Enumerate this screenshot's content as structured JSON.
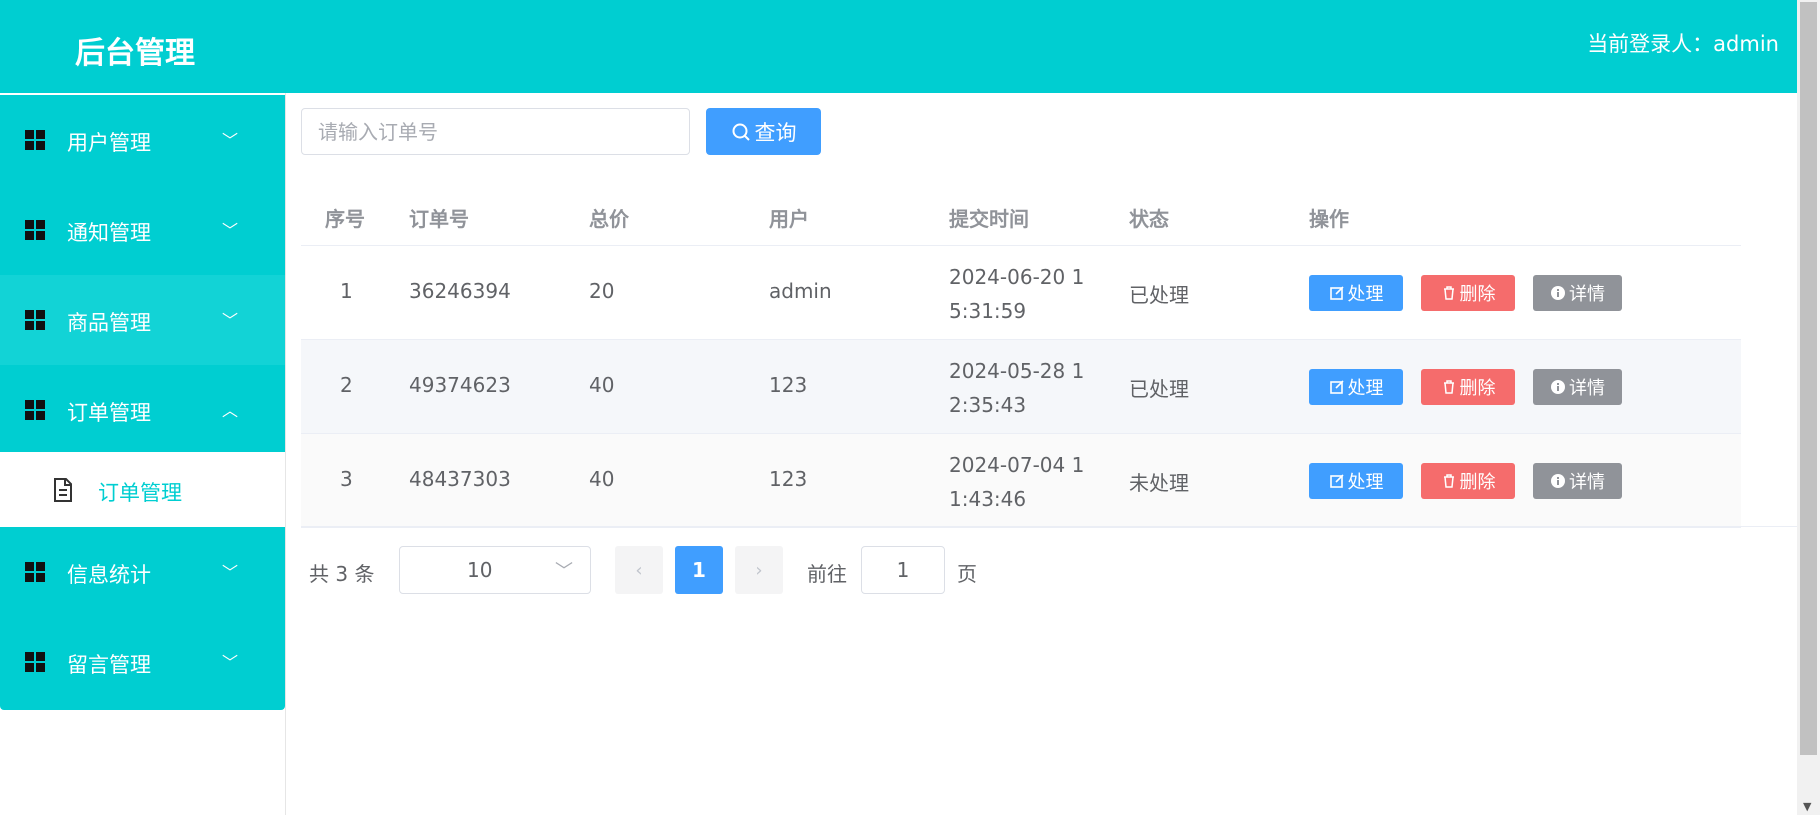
{
  "header": {
    "title": "后台管理",
    "login_text": "当前登录人：admin"
  },
  "sidebar": {
    "items": [
      {
        "label": "用户管理",
        "chevron": "﹀"
      },
      {
        "label": "通知管理",
        "chevron": "﹀"
      },
      {
        "label": "商品管理",
        "chevron": "﹀"
      },
      {
        "label": "订单管理",
        "chevron": "︿"
      },
      {
        "label": "信息统计",
        "chevron": "﹀"
      },
      {
        "label": "留言管理",
        "chevron": "﹀"
      }
    ],
    "submenu": {
      "label": "订单管理"
    }
  },
  "search": {
    "placeholder": "请输入订单号",
    "button_label": "查询"
  },
  "table": {
    "headers": [
      "序号",
      "订单号",
      "总价",
      "用户",
      "提交时间",
      "状态",
      "操作"
    ],
    "rows": [
      {
        "index": "1",
        "order_no": "36246394",
        "total": "20",
        "user": "admin",
        "time": "2024-06-20 15:31:59",
        "status": "已处理"
      },
      {
        "index": "2",
        "order_no": "49374623",
        "total": "40",
        "user": "123",
        "time": "2024-05-28 12:35:43",
        "status": "已处理"
      },
      {
        "index": "3",
        "order_no": "48437303",
        "total": "40",
        "user": "123",
        "time": "2024-07-04 11:43:46",
        "status": "未处理"
      }
    ],
    "actions": {
      "process": "处理",
      "delete": "删除",
      "detail": "详情"
    }
  },
  "pagination": {
    "total_text": "共 3 条",
    "page_size": "10",
    "current_page": "1",
    "goto_label": "前往",
    "goto_value": "1",
    "page_suffix": "页"
  },
  "colors": {
    "header": "#00ced1",
    "primary": "#409eff",
    "danger": "#f56c6c",
    "info": "#909399"
  },
  "icons": [
    "grid-icon",
    "chevron-down-icon",
    "chevron-up-icon",
    "document-icon",
    "search-icon",
    "edit-icon",
    "trash-icon",
    "info-icon",
    "chevron-left-icon",
    "chevron-right-icon"
  ]
}
